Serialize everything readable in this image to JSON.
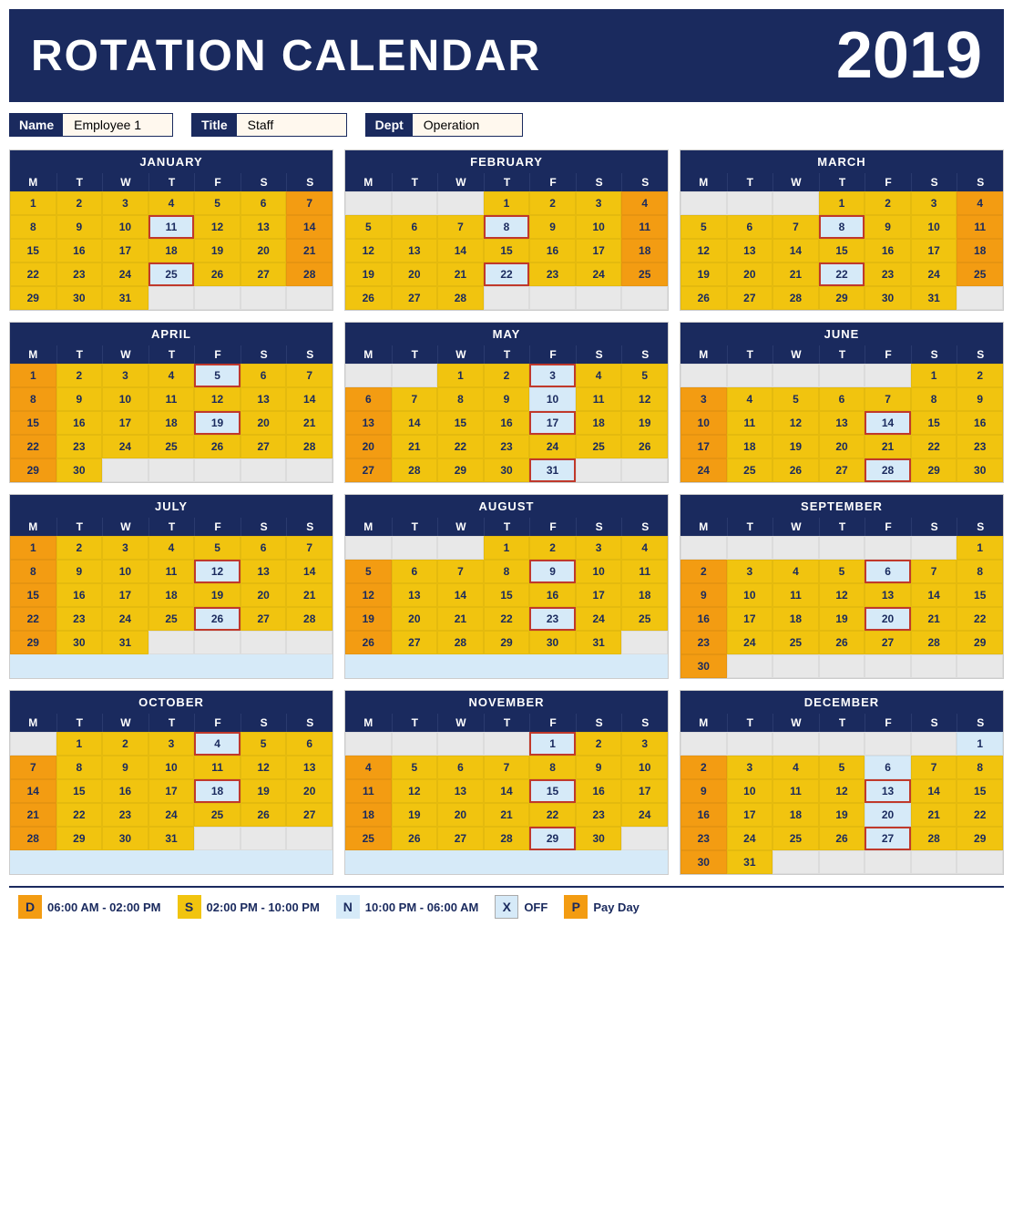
{
  "header": {
    "title": "ROTATION CALENDAR",
    "year": "2019"
  },
  "employee": {
    "name_label": "Name",
    "name_value": "Employee 1",
    "title_label": "Title",
    "title_value": "Staff",
    "dept_label": "Dept",
    "dept_value": "Operation"
  },
  "legend": {
    "d_label": "D",
    "d_text": "06:00 AM - 02:00 PM",
    "s_label": "S",
    "s_text": "02:00 PM - 10:00 PM",
    "n_label": "N",
    "n_text": "10:00 PM - 06:00 AM",
    "x_label": "X",
    "x_text": "OFF",
    "p_label": "P",
    "p_text": "Pay Day"
  },
  "months": [
    {
      "name": "JANUARY",
      "startDay": 1,
      "days": 31,
      "orange": [
        7,
        14,
        21,
        28
      ],
      "yellow": [
        1,
        2,
        3,
        4,
        5,
        6,
        8,
        9,
        10,
        12,
        13,
        15,
        16,
        17,
        18,
        19,
        20,
        22,
        23,
        24,
        26,
        27,
        29,
        30,
        31
      ],
      "payday": [
        11,
        25
      ],
      "empty_before": 0
    },
    {
      "name": "FEBRUARY",
      "startDay": 4,
      "days": 28,
      "orange": [
        4,
        11,
        18,
        25
      ],
      "yellow": [
        1,
        2,
        3,
        5,
        6,
        7,
        9,
        10,
        12,
        13,
        14,
        15,
        16,
        17,
        19,
        20,
        21,
        23,
        24,
        26,
        27,
        28
      ],
      "payday": [
        8,
        22
      ],
      "empty_before": 3
    },
    {
      "name": "MARCH",
      "startDay": 4,
      "days": 31,
      "orange": [
        4,
        11,
        18,
        25
      ],
      "yellow": [
        1,
        2,
        3,
        5,
        6,
        7,
        9,
        10,
        12,
        13,
        14,
        15,
        16,
        17,
        19,
        20,
        21,
        23,
        24,
        26,
        27,
        28,
        29,
        30,
        31
      ],
      "payday": [
        8,
        22
      ],
      "empty_before": 3
    },
    {
      "name": "APRIL",
      "startDay": 1,
      "days": 30,
      "orange": [
        1,
        8,
        15,
        22,
        29
      ],
      "yellow": [
        2,
        3,
        4,
        6,
        7,
        9,
        10,
        11,
        12,
        13,
        14,
        16,
        17,
        18,
        20,
        21,
        23,
        24,
        25,
        26,
        27,
        28,
        30
      ],
      "payday": [
        5,
        19
      ],
      "empty_before": 0
    },
    {
      "name": "MAY",
      "startDay": 3,
      "days": 31,
      "orange": [
        6,
        13,
        20,
        27
      ],
      "yellow": [
        1,
        2,
        4,
        5,
        7,
        8,
        9,
        11,
        12,
        14,
        15,
        16,
        18,
        19,
        21,
        22,
        23,
        24,
        25,
        26,
        28,
        29,
        30
      ],
      "payday": [
        3,
        17,
        31
      ],
      "empty_before": 2
    },
    {
      "name": "JUNE",
      "startDay": 6,
      "days": 30,
      "orange": [
        3,
        10,
        17,
        24
      ],
      "yellow": [
        1,
        2,
        4,
        5,
        6,
        7,
        8,
        9,
        11,
        12,
        13,
        15,
        16,
        18,
        19,
        20,
        21,
        22,
        23,
        25,
        26,
        27,
        29,
        30
      ],
      "payday": [
        14,
        28
      ],
      "empty_before": 5
    },
    {
      "name": "JULY",
      "startDay": 1,
      "days": 31,
      "orange": [
        1,
        8,
        15,
        22,
        29
      ],
      "yellow": [
        2,
        3,
        4,
        5,
        6,
        7,
        9,
        10,
        11,
        13,
        14,
        16,
        17,
        18,
        19,
        20,
        21,
        23,
        24,
        25,
        27,
        28,
        30,
        31
      ],
      "payday": [
        12,
        26
      ],
      "empty_before": 0
    },
    {
      "name": "AUGUST",
      "startDay": 4,
      "days": 31,
      "orange": [
        5,
        12,
        19,
        26
      ],
      "yellow": [
        1,
        2,
        3,
        4,
        6,
        7,
        8,
        10,
        11,
        13,
        14,
        15,
        16,
        17,
        18,
        20,
        21,
        22,
        24,
        25,
        27,
        28,
        29,
        30,
        31
      ],
      "payday": [
        9,
        23
      ],
      "empty_before": 3
    },
    {
      "name": "SEPTEMBER",
      "startDay": 0,
      "days": 30,
      "orange": [
        2,
        9,
        16,
        23,
        30
      ],
      "yellow": [
        1,
        3,
        4,
        5,
        7,
        8,
        10,
        11,
        12,
        13,
        14,
        15,
        17,
        18,
        19,
        21,
        22,
        24,
        25,
        26,
        27,
        28,
        29
      ],
      "payday": [
        6,
        20
      ],
      "empty_before": 6
    },
    {
      "name": "OCTOBER",
      "startDay": 1,
      "days": 31,
      "orange": [
        7,
        14,
        21,
        28
      ],
      "yellow": [
        1,
        2,
        3,
        5,
        6,
        8,
        9,
        10,
        11,
        12,
        13,
        15,
        16,
        17,
        19,
        20,
        22,
        23,
        24,
        25,
        26,
        27,
        29,
        30,
        31
      ],
      "payday": [
        4,
        18
      ],
      "empty_before": 1
    },
    {
      "name": "NOVEMBER",
      "startDay": 4,
      "days": 30,
      "orange": [
        4,
        11,
        18,
        25
      ],
      "yellow": [
        2,
        3,
        5,
        6,
        7,
        8,
        9,
        10,
        12,
        13,
        14,
        16,
        17,
        19,
        20,
        21,
        22,
        23,
        24,
        26,
        27,
        28,
        30
      ],
      "payday": [
        1,
        15,
        29
      ],
      "empty_before": 4
    },
    {
      "name": "DECEMBER",
      "startDay": 0,
      "days": 31,
      "orange": [
        2,
        9,
        16,
        23,
        30
      ],
      "yellow": [
        3,
        4,
        5,
        7,
        8,
        10,
        11,
        12,
        14,
        15,
        17,
        18,
        19,
        21,
        22,
        24,
        25,
        26,
        28,
        29,
        31
      ],
      "payday": [
        13,
        27
      ],
      "empty_before": 6
    }
  ]
}
